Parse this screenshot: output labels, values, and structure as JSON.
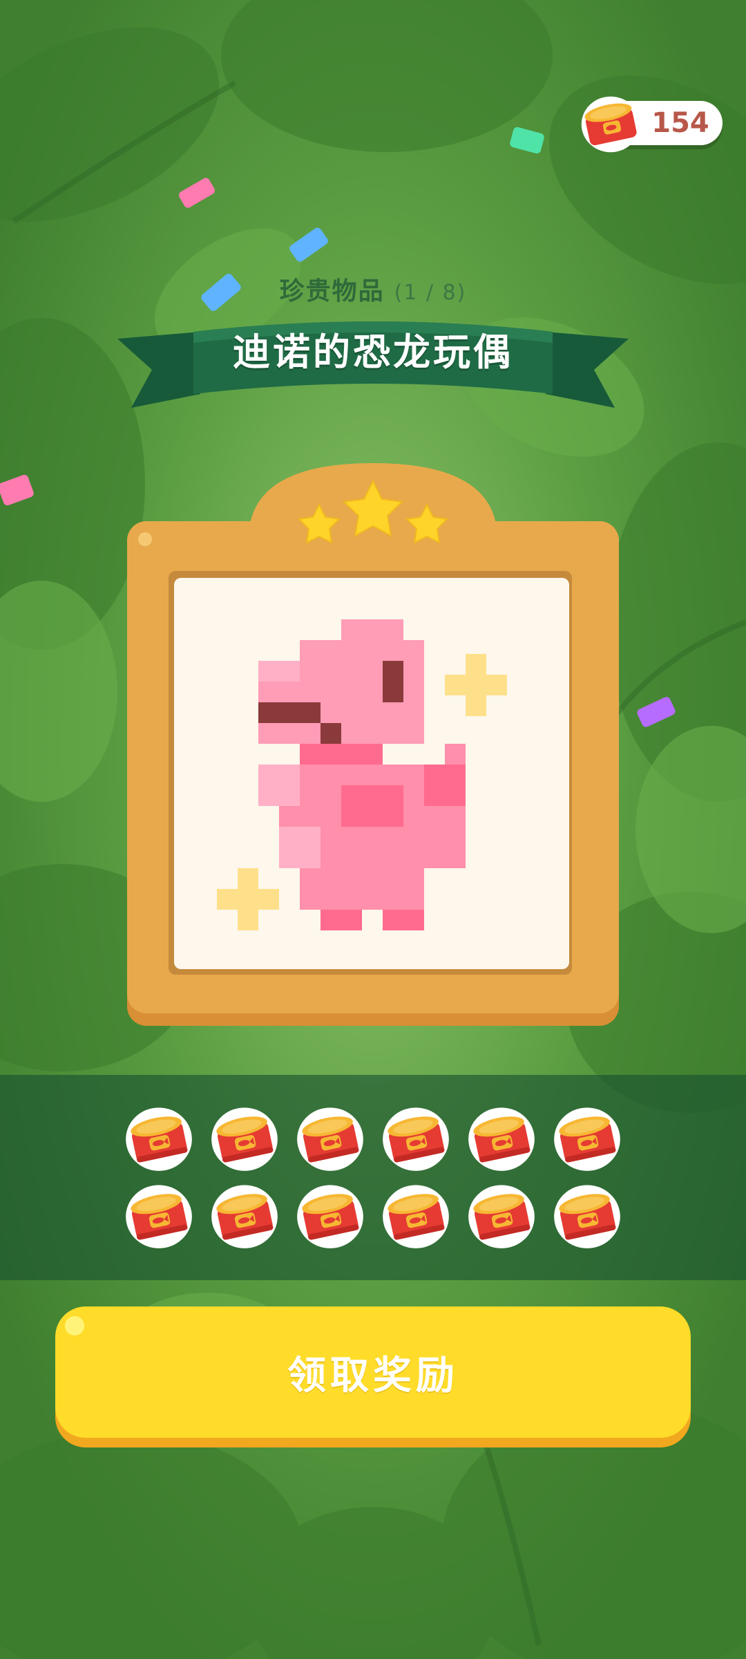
{
  "currency": {
    "icon": "cat-food-can-icon",
    "value": "154"
  },
  "item": {
    "category": "珍贵物品",
    "progress": "(1 / 8)",
    "name": "迪诺的恐龙玩偶",
    "stars": 3,
    "image_icon": "pink-pixel-dinosaur-icon"
  },
  "reward": {
    "icon": "cat-food-can-icon",
    "count": 12
  },
  "button": {
    "label": "领取奖励"
  },
  "colors": {
    "background": "#4f8f38",
    "frame": "#e8a94c",
    "ribbon": "#1f6b45",
    "button": "#ffdc2a",
    "dino": "#ff8fab"
  }
}
